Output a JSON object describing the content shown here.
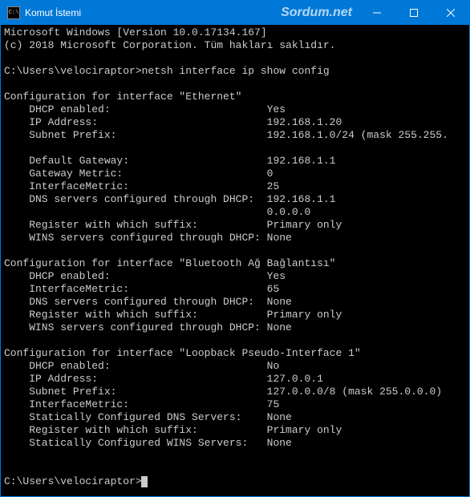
{
  "window": {
    "title": "Komut İstemi",
    "icon_label": "C:\\",
    "watermark": "Sordum.net"
  },
  "terminal": {
    "header_version": "Microsoft Windows [Version 10.0.17134.167]",
    "header_copyright": "(c) 2018 Microsoft Corporation. Tüm hakları saklıdır.",
    "prompt_path": "C:\\Users\\velociraptor>",
    "command": "netsh interface ip show config",
    "interfaces": [
      {
        "name": "Ethernet",
        "rows": [
          {
            "label": "DHCP enabled:",
            "value": "Yes"
          },
          {
            "label": "IP Address:",
            "value": "192.168.1.20"
          },
          {
            "label": "Subnet Prefix:",
            "value": "192.168.1.0/24 (mask 255.255."
          },
          {
            "label": "",
            "value": ""
          },
          {
            "label": "Default Gateway:",
            "value": "192.168.1.1"
          },
          {
            "label": "Gateway Metric:",
            "value": "0"
          },
          {
            "label": "InterfaceMetric:",
            "value": "25"
          },
          {
            "label": "DNS servers configured through DHCP:",
            "value": "192.168.1.1"
          },
          {
            "label": "",
            "value": "0.0.0.0"
          },
          {
            "label": "Register with which suffix:",
            "value": "Primary only"
          },
          {
            "label": "WINS servers configured through DHCP:",
            "value": "None"
          }
        ]
      },
      {
        "name": "Bluetooth Ağ Bağlantısı",
        "rows": [
          {
            "label": "DHCP enabled:",
            "value": "Yes"
          },
          {
            "label": "InterfaceMetric:",
            "value": "65"
          },
          {
            "label": "DNS servers configured through DHCP:",
            "value": "None"
          },
          {
            "label": "Register with which suffix:",
            "value": "Primary only"
          },
          {
            "label": "WINS servers configured through DHCP:",
            "value": "None"
          }
        ]
      },
      {
        "name": "Loopback Pseudo-Interface 1",
        "rows": [
          {
            "label": "DHCP enabled:",
            "value": "No"
          },
          {
            "label": "IP Address:",
            "value": "127.0.0.1"
          },
          {
            "label": "Subnet Prefix:",
            "value": "127.0.0.0/8 (mask 255.0.0.0)"
          },
          {
            "label": "InterfaceMetric:",
            "value": "75"
          },
          {
            "label": "Statically Configured DNS Servers:",
            "value": "None"
          },
          {
            "label": "Register with which suffix:",
            "value": "Primary only"
          },
          {
            "label": "Statically Configured WINS Servers:",
            "value": "None"
          }
        ]
      }
    ],
    "end_prompt": "C:\\Users\\velociraptor>"
  }
}
